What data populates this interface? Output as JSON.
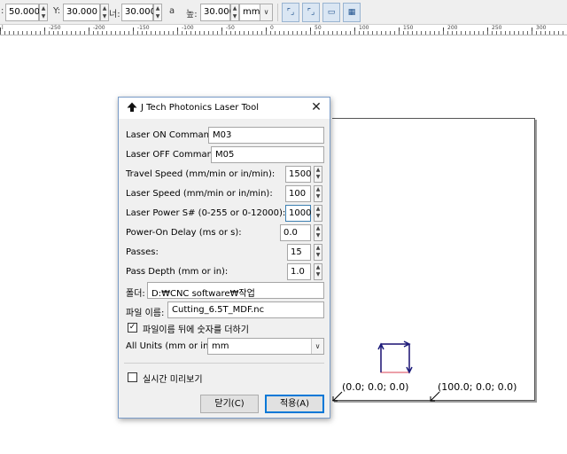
{
  "toolbar": {
    "x_value": "50.000",
    "y_label": "Y:",
    "y_value": "30.000",
    "w_label": "너:",
    "w_value": "30.000",
    "lock_glyph": "a",
    "h_label": "높:",
    "h_value": "30.000",
    "unit": "mm",
    "spin_up": "▲",
    "spin_down": "▼",
    "dropdown": "∨"
  },
  "ruler": {
    "labels": [
      "-250",
      "-200",
      "-150",
      "-100",
      "-50",
      "0",
      "50",
      "100",
      "150",
      "200",
      "250",
      "300"
    ]
  },
  "dialog": {
    "title": "J Tech Photonics Laser Tool",
    "close": "✕",
    "laser_on_label": "Laser ON Command:",
    "laser_on_value": "M03",
    "laser_off_label": "Laser OFF Command:",
    "laser_off_value": "M05",
    "travel_speed_label": "Travel Speed (mm/min or in/min):",
    "travel_speed_value": "1500",
    "laser_speed_label": "Laser Speed (mm/min or in/min):",
    "laser_speed_value": "100",
    "laser_power_label": "Laser Power S# (0-255 or 0-12000):",
    "laser_power_value": "1000",
    "power_delay_label": "Power-On Delay (ms or s):",
    "power_delay_value": "0.0",
    "passes_label": "Passes:",
    "passes_value": "15",
    "pass_depth_label": "Pass Depth (mm or in):",
    "pass_depth_value": "1.0",
    "folder_label": "폴더:",
    "folder_value": "D:₩CNC software₩작업",
    "filename_label": "파일 이름:",
    "filename_value": "Cutting_6.5T_MDF.nc",
    "append_number_label": "파일이름 뒤에 숫자를 더하기",
    "append_number_checked": true,
    "check_mark": "✓",
    "units_label": "All Units (mm or in):",
    "units_value": "mm",
    "live_preview_label": "실시간 미리보기",
    "live_preview_checked": false,
    "close_button": "닫기(C)",
    "apply_button": "적용(A)"
  },
  "canvas": {
    "origin_label": "(0.0; 0.0; 0.0)",
    "x_end_label": "(100.0; 0.0; 0.0)",
    "path_color": "#e06070",
    "arrow_color": "#1a1a7a"
  }
}
